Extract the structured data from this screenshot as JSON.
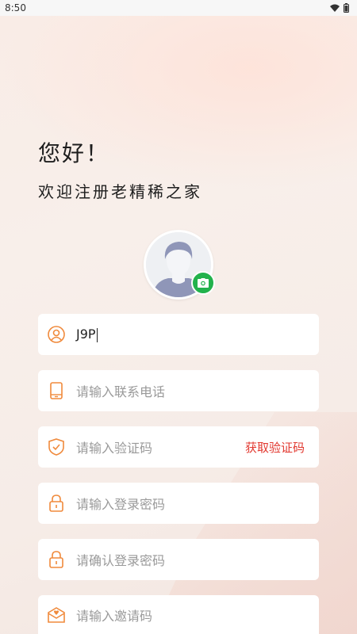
{
  "status_bar": {
    "time": "8:50"
  },
  "header": {
    "greeting": "您好！",
    "welcome": "欢迎注册老精稀之家"
  },
  "avatar": {
    "icon": "camera-icon",
    "badge_color": "#22b24c"
  },
  "form": {
    "username": {
      "value": "J9P",
      "icon": "user-icon"
    },
    "phone": {
      "placeholder": "请输入联系电话",
      "icon": "phone-icon"
    },
    "code": {
      "placeholder": "请输入验证码",
      "icon": "shield-icon",
      "action_label": "获取验证码"
    },
    "password": {
      "placeholder": "请输入登录密码",
      "icon": "lock-icon"
    },
    "confirm_password": {
      "placeholder": "请确认登录密码",
      "icon": "lock-icon"
    },
    "invite": {
      "placeholder": "请输入邀请码",
      "icon": "invite-mail-icon"
    }
  },
  "colors": {
    "accent": "#f08a3c",
    "link": "#e2382f"
  }
}
